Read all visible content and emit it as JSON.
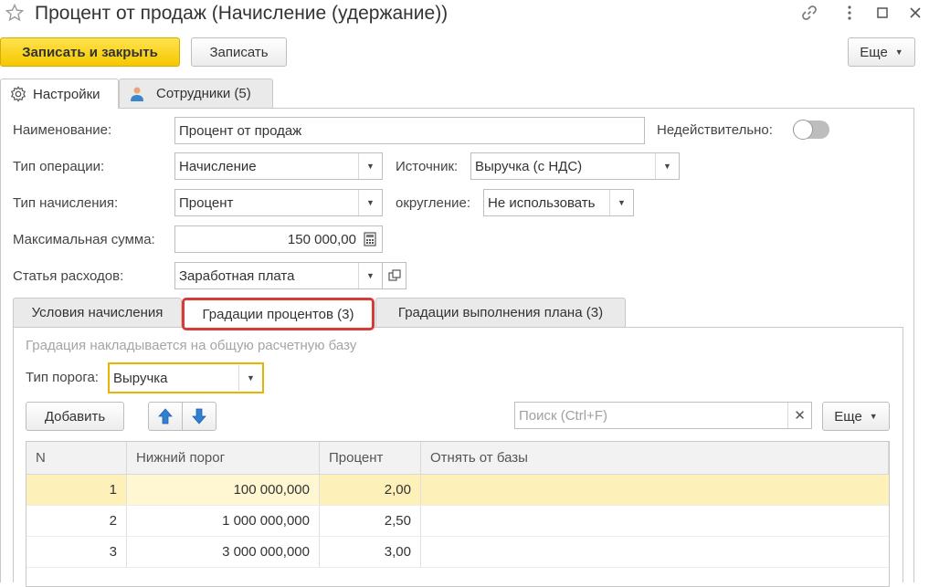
{
  "window": {
    "title": "Процент от продаж (Начисление (удержание))",
    "icons": [
      "star-icon",
      "link-icon",
      "more-vertical-icon",
      "minimize-icon",
      "close-icon"
    ]
  },
  "toolbar": {
    "save_close_label": "Записать и закрыть",
    "save_label": "Записать",
    "more_label": "Еще"
  },
  "tabs": [
    {
      "label": "Настройки",
      "icon": "gear-icon",
      "active": true
    },
    {
      "label": "Сотрудники (5)",
      "icon": "person-icon",
      "active": false
    }
  ],
  "form": {
    "name_label": "Наименование:",
    "name_value": "Процент от продаж",
    "invalid_label": "Недействительно:",
    "invalid_on": false,
    "op_type_label": "Тип операции:",
    "op_type_value": "Начисление",
    "source_label": "Источник:",
    "source_value": "Выручка (с НДС)",
    "calc_type_label": "Тип начисления:",
    "calc_type_value": "Процент",
    "rounding_label": "округление:",
    "rounding_value": "Не использовать",
    "max_sum_label": "Максимальная сумма:",
    "max_sum_value": "150 000,00",
    "expense_label": "Статья расходов:",
    "expense_value": "Заработная плата"
  },
  "inner_tabs": [
    {
      "label": "Условия начисления",
      "active": false
    },
    {
      "label": "Градации процентов (3)",
      "active": true
    },
    {
      "label": "Градации выполнения плана (3)",
      "active": false
    }
  ],
  "gradations": {
    "hint": "Градация накладывается на общую расчетную базу",
    "threshold_label": "Тип порога:",
    "threshold_value": "Выручка",
    "add_label": "Добавить",
    "search_placeholder": "Поиск (Ctrl+F)",
    "more_label": "Еще",
    "columns": [
      "N",
      "Нижний порог",
      "Процент",
      "Отнять от базы"
    ],
    "rows": [
      {
        "n": "1",
        "lower": "100 000,000",
        "pct": "2,00",
        "subtract": ""
      },
      {
        "n": "2",
        "lower": "1 000 000,000",
        "pct": "2,50",
        "subtract": ""
      },
      {
        "n": "3",
        "lower": "3 000 000,000",
        "pct": "3,00",
        "subtract": ""
      }
    ]
  },
  "colors": {
    "primary": "#f6c800",
    "selected_row": "#fdf0b8",
    "highlight_border": "#d93a36",
    "focus_border": "#e8b400"
  }
}
